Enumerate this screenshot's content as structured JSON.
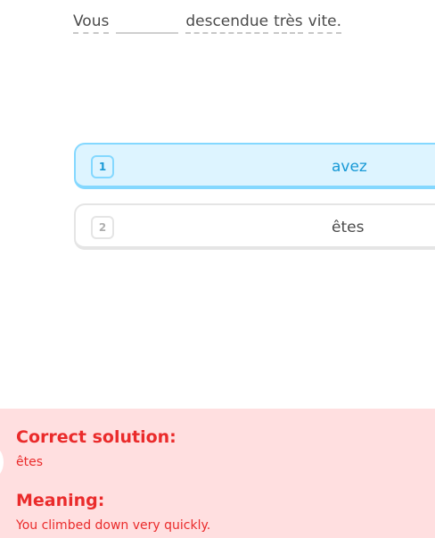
{
  "sentence": {
    "before": "Vous",
    "after_word1": "descendue",
    "after_word2": "très",
    "after_word3": "vite."
  },
  "choices": [
    {
      "number": "1",
      "label": "avez",
      "selected": true
    },
    {
      "number": "2",
      "label": "êtes",
      "selected": false
    }
  ],
  "feedback": {
    "solution_heading": "Correct solution:",
    "solution_text": "êtes",
    "meaning_heading": "Meaning:",
    "meaning_text": "You climbed down very quickly."
  },
  "colors": {
    "selected_bg": "#ddf4ff",
    "selected_border": "#84d8ff",
    "selected_text": "#1899d6",
    "feedback_bg": "#ffdfe0",
    "feedback_text": "#ea2b2b"
  }
}
